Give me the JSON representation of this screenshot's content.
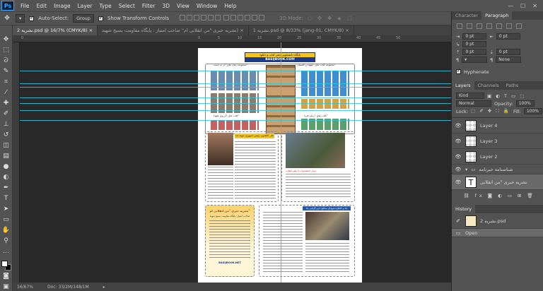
{
  "app": {
    "logo": "Ps",
    "accent": "#31a8ff"
  },
  "menu": [
    "File",
    "Edit",
    "Image",
    "Layer",
    "Type",
    "Select",
    "Filter",
    "3D",
    "View",
    "Window",
    "Help"
  ],
  "window_controls": [
    "—",
    "☐",
    "✕"
  ],
  "options": {
    "auto_select_label": "Auto-Select:",
    "auto_select_value": "Group",
    "transform_label": "Show Transform Controls",
    "mode_label": "3D Mode:"
  },
  "tabs": [
    {
      "label": "نشریه 2.psd @ 16/7% (CMYK/8) ×"
    },
    {
      "label": "نشریه خبری \"من انقلابی ام\" صاحب امتیاز : پایگاه مقاومت بسیج شهید) ×"
    },
    {
      "label": "نشریه 1.psd @ 8/33% (jang-01, CMYK/8) ×"
    }
  ],
  "ruler_marks": [
    "0",
    "0",
    "5",
    "10",
    "15",
    "20",
    "25",
    "30",
    "35",
    "40",
    "45",
    "50"
  ],
  "status": {
    "zoom": "16/67%",
    "doc": "Doc: 33/2M/148/1M"
  },
  "panels": {
    "char_tabs": [
      "Character",
      "Paragraph"
    ],
    "para_fields": [
      "0 pt",
      "0 pt",
      "0 pt",
      "0 pt",
      "0 pt"
    ],
    "none_value": "None",
    "hyphenate": "Hyphenate",
    "layers_tabs": [
      "Layers",
      "Channels",
      "Paths"
    ],
    "kind": "Kind",
    "blend": "Normal",
    "opacity_label": "Opacity:",
    "opacity_value": "100%",
    "lock_label": "Lock:",
    "fill_label": "Fill:",
    "fill_value": "100%",
    "layers": [
      {
        "name": "Layer 4",
        "type": "pixel"
      },
      {
        "name": "Layer 3",
        "type": "pixel"
      },
      {
        "name": "Layer 2",
        "type": "pixel"
      },
      {
        "name": "شناسنامه خبرنامه",
        "type": "group"
      },
      {
        "name": "نشریه خبری \"من انقلابی",
        "type": "text"
      }
    ],
    "history_tab": "History",
    "history_items": [
      "نشریه 2.psd",
      "Open"
    ]
  },
  "document": {
    "header_top": "پایگاه دانشجویی نشر کتاب و دانلود",
    "header_url": "BASIJBOOK.COM",
    "header_color": "#f5c518",
    "sections": [
      "مجموعه رمان های \"از نه دست\"",
      "مجموعه کتاب های \"شهدا و گلستان\"",
      "کتاب های \"آرزوی شهدا\"",
      "کتاب های \"زمان فردا\""
    ],
    "article1_title": "علی کلاهدوز، رئیس جمهوری شهید شد",
    "article2_title": "دیدار دانشجویان با رهبر انقلاب",
    "sidebar_title": "نشریه خبری \"من انقلابی ام\"",
    "sidebar_subtitle": "صاحب امتیاز: پایگاه مقاومت بسیج شهید",
    "site_label": "BASIJBOOK.NET",
    "article3_title": "یاد و خاطره شهدای مدافع حرم گرامی باد"
  }
}
